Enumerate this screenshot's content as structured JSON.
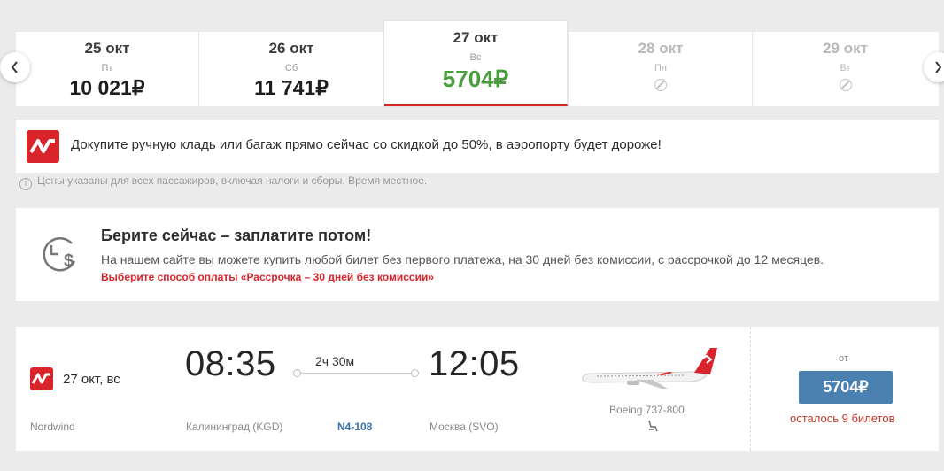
{
  "date_strip": {
    "days": [
      {
        "date": "25 окт",
        "weekday": "Пт",
        "price": "10 021₽",
        "available": true,
        "active": false
      },
      {
        "date": "26 окт",
        "weekday": "Сб",
        "price": "11 741₽",
        "available": true,
        "active": false
      },
      {
        "date": "27 окт",
        "weekday": "Вс",
        "price": "5704₽",
        "available": true,
        "active": true
      },
      {
        "date": "28 окт",
        "weekday": "Пн",
        "price": "",
        "available": false,
        "active": false
      },
      {
        "date": "29 окт",
        "weekday": "Вт",
        "price": "",
        "available": false,
        "active": false
      }
    ],
    "prev_icon": "chevron-left-icon",
    "next_icon": "chevron-right-icon"
  },
  "promo": {
    "text": "Докупите ручную кладь или багаж прямо сейчас со скидкой до 50%, в аэропорту будет дороже!"
  },
  "note": {
    "text": "Цены указаны для всех пассажиров, включая налоги и сборы. Время местное."
  },
  "installment": {
    "title": "Берите сейчас – заплатите потом!",
    "description": "На нашем сайте вы можете купить любой билет без первого платежа, на 30 дней без комиссии, с рассрочкой до 12 месяцев.",
    "link": "Выберите способ оплаты «Рассрочка – 30 дней без комиссии»"
  },
  "flight": {
    "date": "27 окт, вс",
    "airline": "Nordwind",
    "departure_time": "08:35",
    "departure_city": "Калининград (KGD)",
    "duration": "2ч 30м",
    "flight_number": "N4-108",
    "arrival_time": "12:05",
    "arrival_city": "Москва (SVO)",
    "aircraft": "Boeing 737-800",
    "price_prefix": "от",
    "price": "5704₽",
    "seats_left": "осталось 9 билетов"
  },
  "colors": {
    "brand_red": "#d9242c",
    "price_green": "#4a9d3c",
    "button_blue": "#4a81b0"
  }
}
